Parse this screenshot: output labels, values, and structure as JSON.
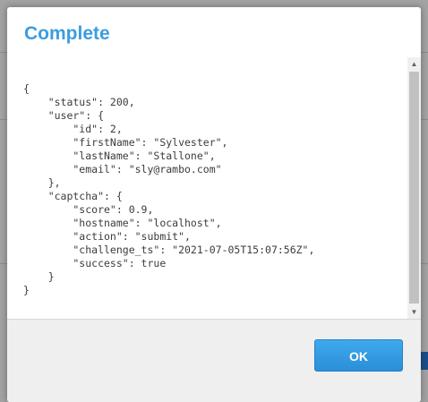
{
  "dialog": {
    "title": "Complete",
    "ok_label": "OK",
    "response_json": "{\n    \"status\": 200,\n    \"user\": {\n        \"id\": 2,\n        \"firstName\": \"Sylvester\",\n        \"lastName\": \"Stallone\",\n        \"email\": \"sly@rambo.com\"\n    },\n    \"captcha\": {\n        \"score\": 0.9,\n        \"hostname\": \"localhost\",\n        \"action\": \"submit\",\n        \"challenge_ts\": \"2021-07-05T15:07:56Z\",\n        \"success\": true\n    }\n}"
  },
  "scrollbar": {
    "up_icon": "chevron-up",
    "down_icon": "chevron-down"
  },
  "colors": {
    "title": "#3b9de0",
    "button": "#2a8fd8",
    "overlay": "#9a9a9a"
  }
}
